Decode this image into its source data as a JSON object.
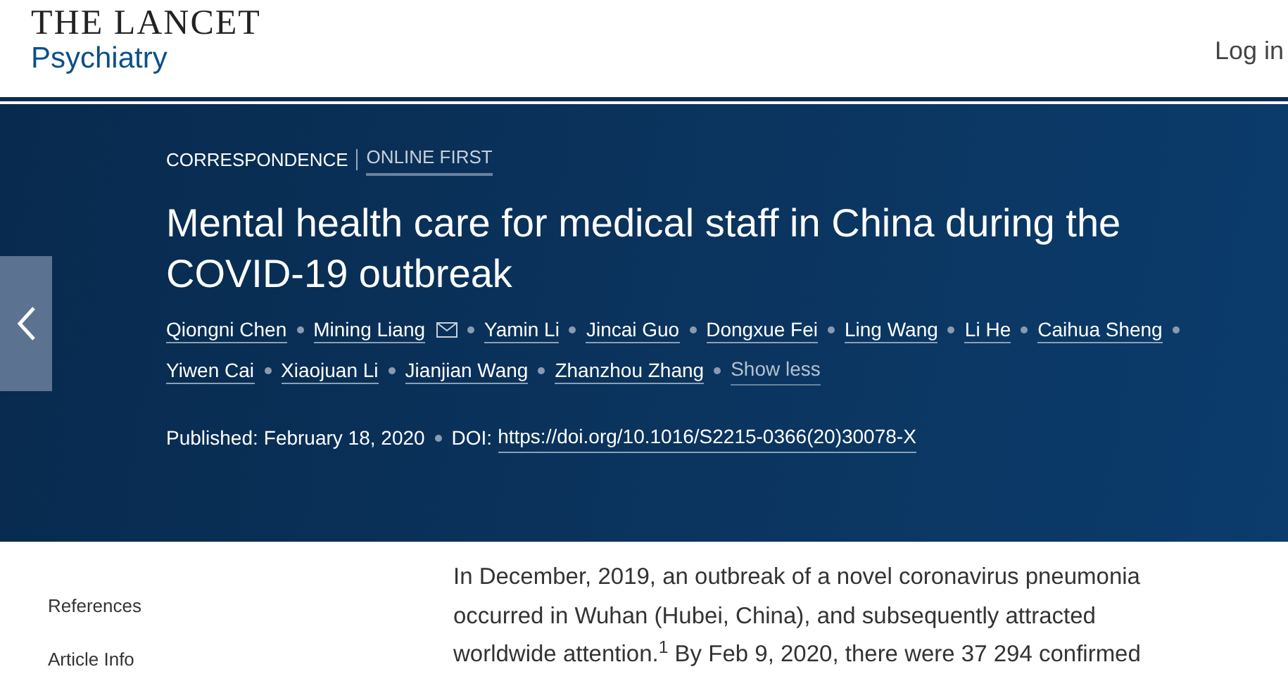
{
  "header": {
    "logo_top": "THE LANCET",
    "logo_bottom": "Psychiatry",
    "login": "Log in"
  },
  "article": {
    "type": "CORRESPONDENCE",
    "status": "ONLINE FIRST",
    "title": "Mental health care for medical staff in China during the COVID-19 outbreak",
    "authors": [
      {
        "name": "Qiongni Chen",
        "email": false
      },
      {
        "name": "Mining Liang",
        "email": true
      },
      {
        "name": "Yamin Li",
        "email": false
      },
      {
        "name": "Jincai Guo",
        "email": false
      },
      {
        "name": "Dongxue Fei",
        "email": false
      },
      {
        "name": "Ling Wang",
        "email": false
      },
      {
        "name": "Li He",
        "email": false
      },
      {
        "name": "Caihua Sheng",
        "email": false
      },
      {
        "name": "Yiwen Cai",
        "email": false
      },
      {
        "name": "Xiaojuan Li",
        "email": false
      },
      {
        "name": "Jianjian Wang",
        "email": false
      },
      {
        "name": "Zhanzhou Zhang",
        "email": false
      }
    ],
    "show_less": "Show less",
    "published_label": "Published:",
    "published_date": "February 18, 2020",
    "doi_label": "DOI:",
    "doi": "https://doi.org/10.1016/S2215-0366(20)30078-X"
  },
  "sidebar": {
    "items": [
      "References",
      "Article Info"
    ]
  },
  "body": "In December, 2019, an outbreak of a novel coronavirus pneumonia occurred in Wuhan (Hubei, China), and subsequently attracted worldwide attention.$^{1}$ By Feb 9, 2020, there were 37 294 confirmed"
}
